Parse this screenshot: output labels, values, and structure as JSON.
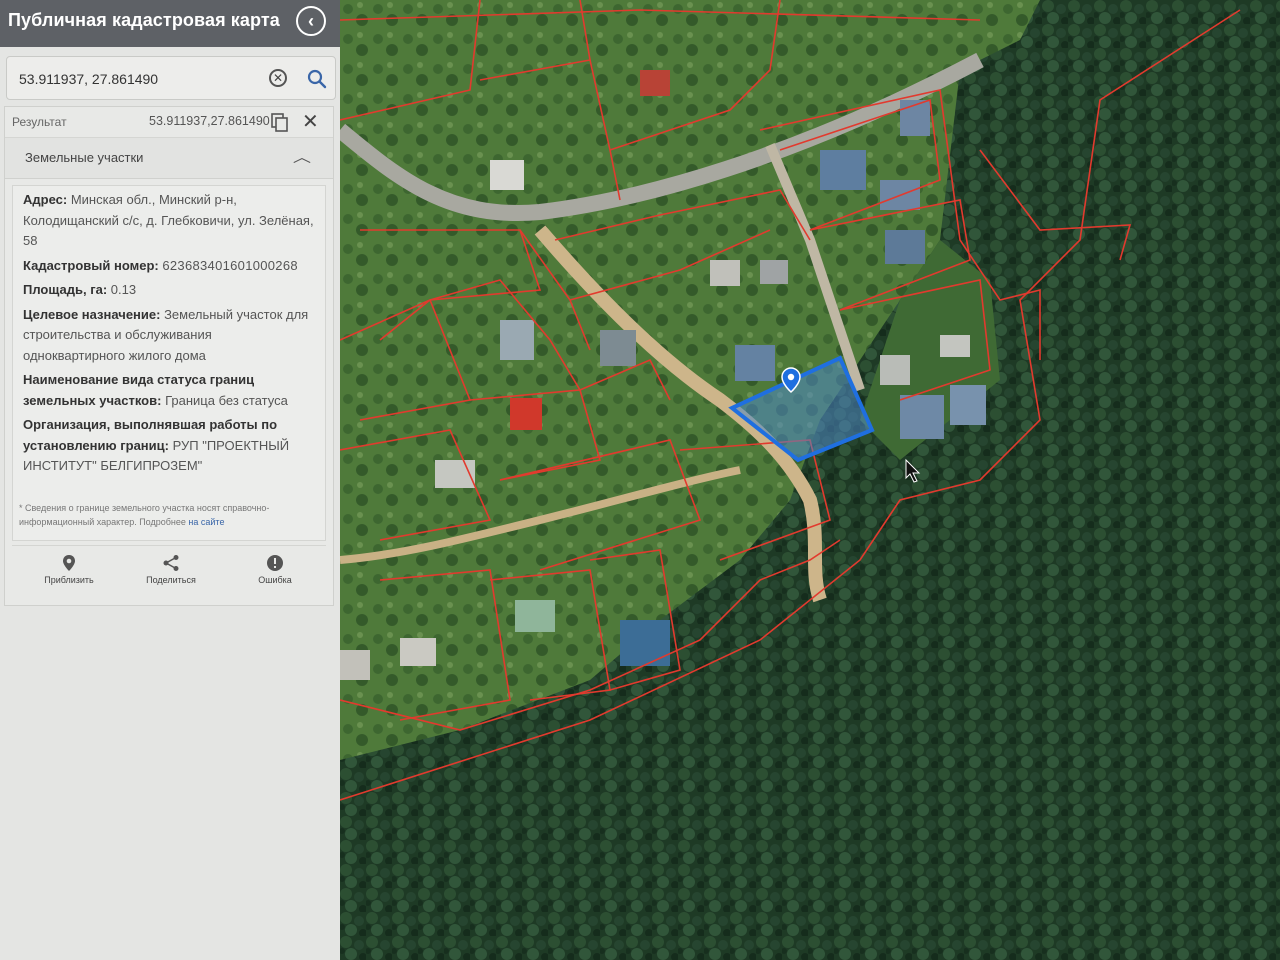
{
  "app": {
    "title": "Публичная кадастровая карта"
  },
  "search": {
    "value": "53.911937, 27.861490"
  },
  "result": {
    "label": "Результат",
    "coords": "53.911937,27.861490",
    "section_title": "Земельные участки",
    "fields": {
      "address_label": "Адрес:",
      "address_value": "Минская обл., Минский р-н, Колодищанский с/с, д. Глебковичи, ул. Зелёная, 58",
      "cadastral_label": "Кадастровый номер:",
      "cadastral_value": "623683401601000268",
      "area_label": "Площадь, га:",
      "area_value": "0.13",
      "purpose_label": "Целевое назначение:",
      "purpose_value": "Земельный участок для строительства и обслуживания одноквартирного жилого дома",
      "status_label": "Наименование вида статуса границ земельных участков:",
      "status_value": "Граница без статуса",
      "org_label": "Организация, выполнявшая работы по установлению границ:",
      "org_value": "РУП \"ПРОЕКТНЫЙ ИНСТИТУТ\" БЕЛГИПРОЗЕМ\""
    },
    "note_text": "* Сведения о границе земельного участка носят справочно-информационный характер. Подробнее",
    "note_link": "на сайте",
    "actions": {
      "zoom": "Приблизить",
      "share": "Поделиться",
      "error": "Ошибка"
    }
  },
  "colors": {
    "topbar": "#5e6166",
    "boundary": "#e23a2e",
    "selected_parcel": "#1f6fe0",
    "forest": "#1f3a26"
  }
}
